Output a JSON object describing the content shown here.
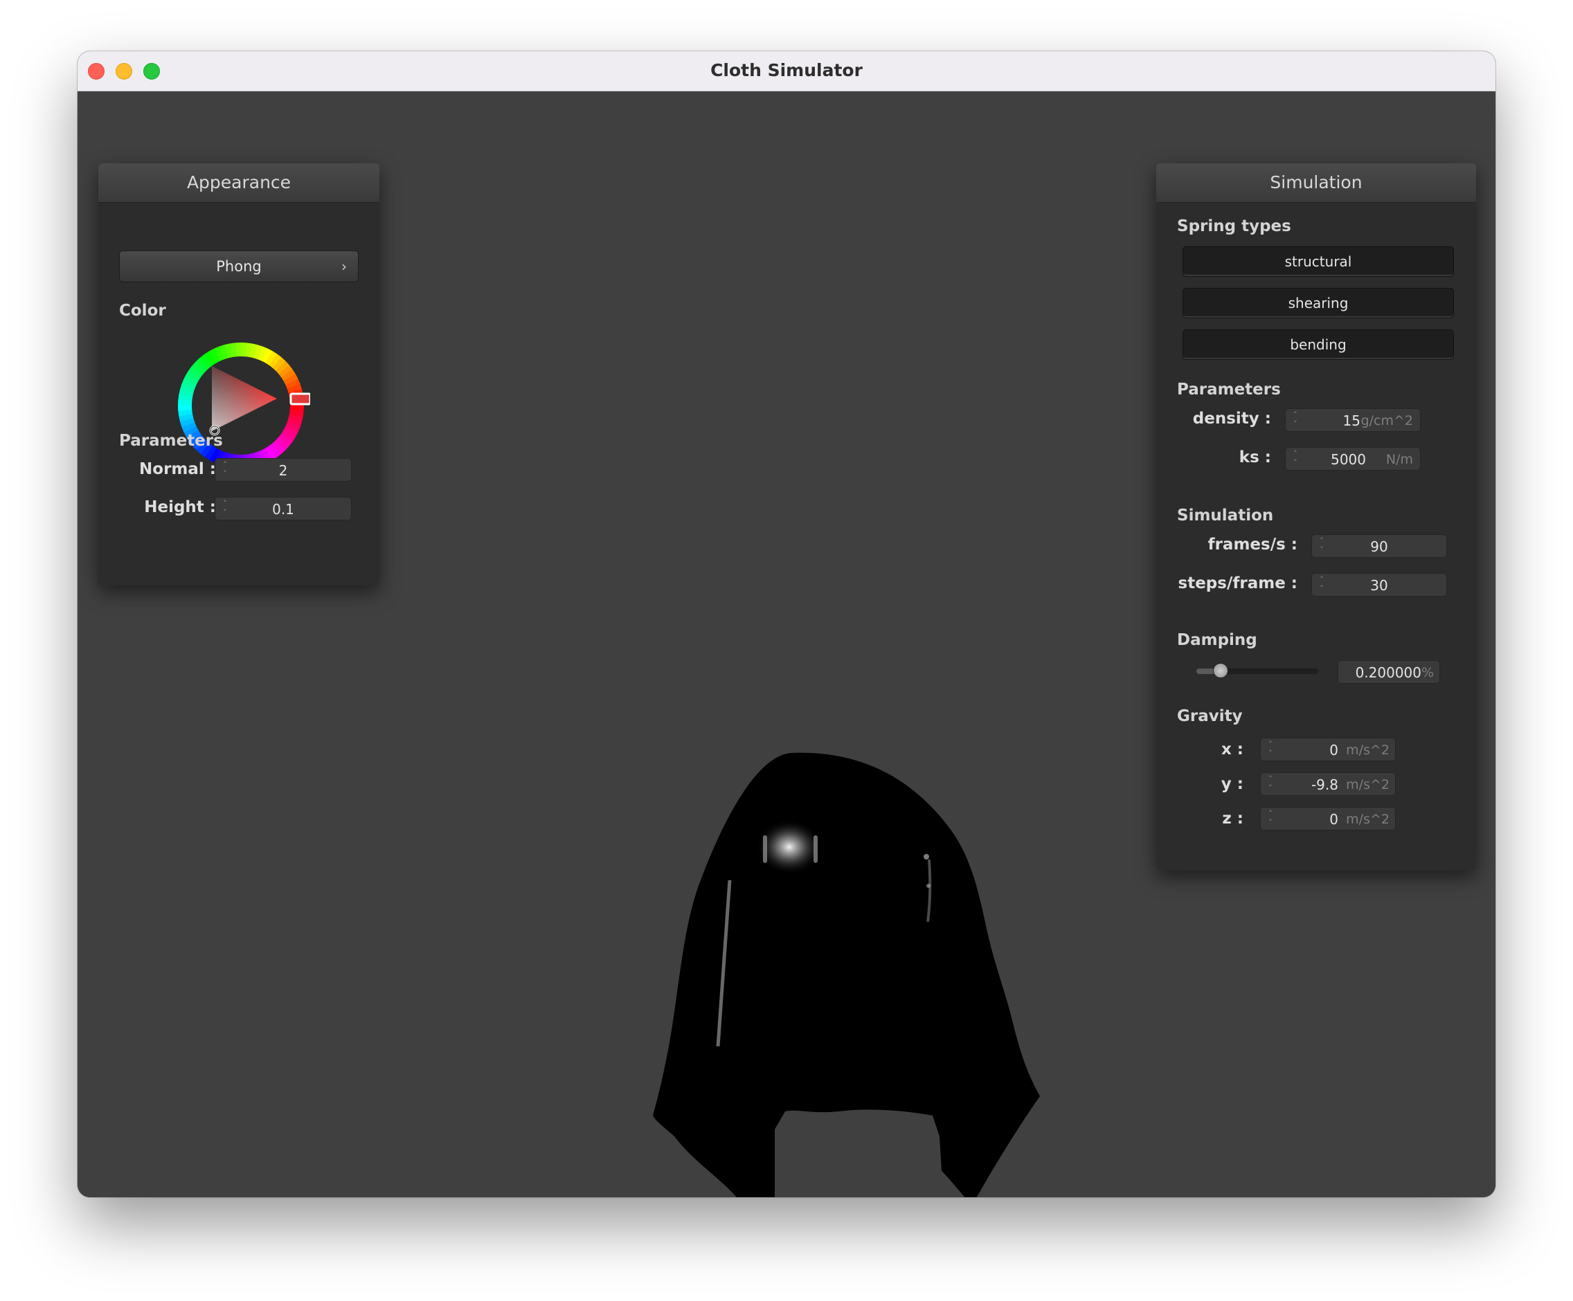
{
  "window": {
    "title": "Cloth Simulator"
  },
  "appearance": {
    "header": "Appearance",
    "shader": "Phong",
    "color_label": "Color",
    "color": "#ff0000",
    "params_label": "Parameters",
    "normal_label": "Normal :",
    "normal_value": "2",
    "height_label": "Height :",
    "height_value": "0.1"
  },
  "simulation": {
    "header": "Simulation",
    "spring_types_label": "Spring types",
    "springs": [
      "structural",
      "shearing",
      "bending"
    ],
    "params_label": "Parameters",
    "density_label": "density :",
    "density_value": "15",
    "density_unit": "g/cm^2",
    "ks_label": "ks :",
    "ks_value": "5000",
    "ks_unit": "N/m",
    "sim_label": "Simulation",
    "fps_label": "frames/s :",
    "fps_value": "90",
    "steps_label": "steps/frame :",
    "steps_value": "30",
    "damping_label": "Damping",
    "damping_value": "0.200000",
    "damping_unit": "%",
    "damping_slider_fraction": 0.2,
    "gravity_label": "Gravity",
    "x_label": "x :",
    "x_value": "0",
    "y_label": "y :",
    "y_value": "-9.8",
    "z_label": "z :",
    "z_value": "0",
    "gravity_unit": "m/s^2"
  }
}
